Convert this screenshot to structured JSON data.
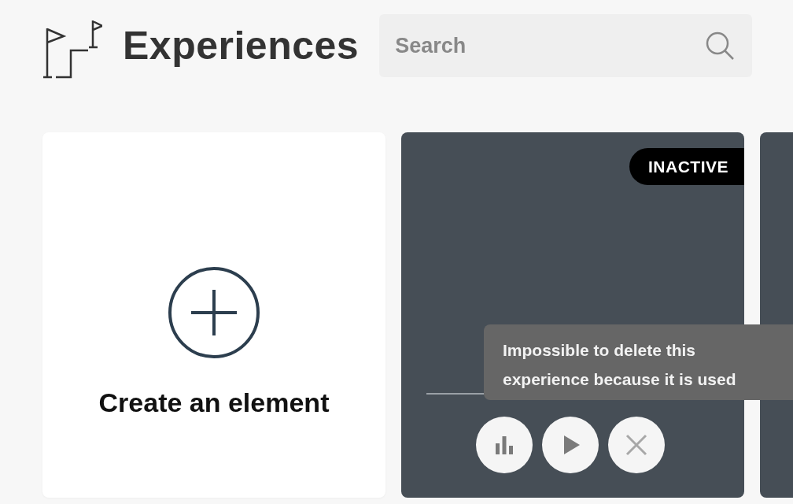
{
  "header": {
    "title": "Experiences"
  },
  "search": {
    "placeholder": "Search"
  },
  "create_card": {
    "label": "Create an element"
  },
  "experience_card": {
    "status": "INACTIVE",
    "actions": [
      {
        "kind": "stats",
        "disabled": false
      },
      {
        "kind": "play",
        "disabled": false
      },
      {
        "kind": "delete",
        "disabled": true
      }
    ]
  },
  "tooltip": {
    "text": "Impossible to delete this experience because it is used"
  }
}
